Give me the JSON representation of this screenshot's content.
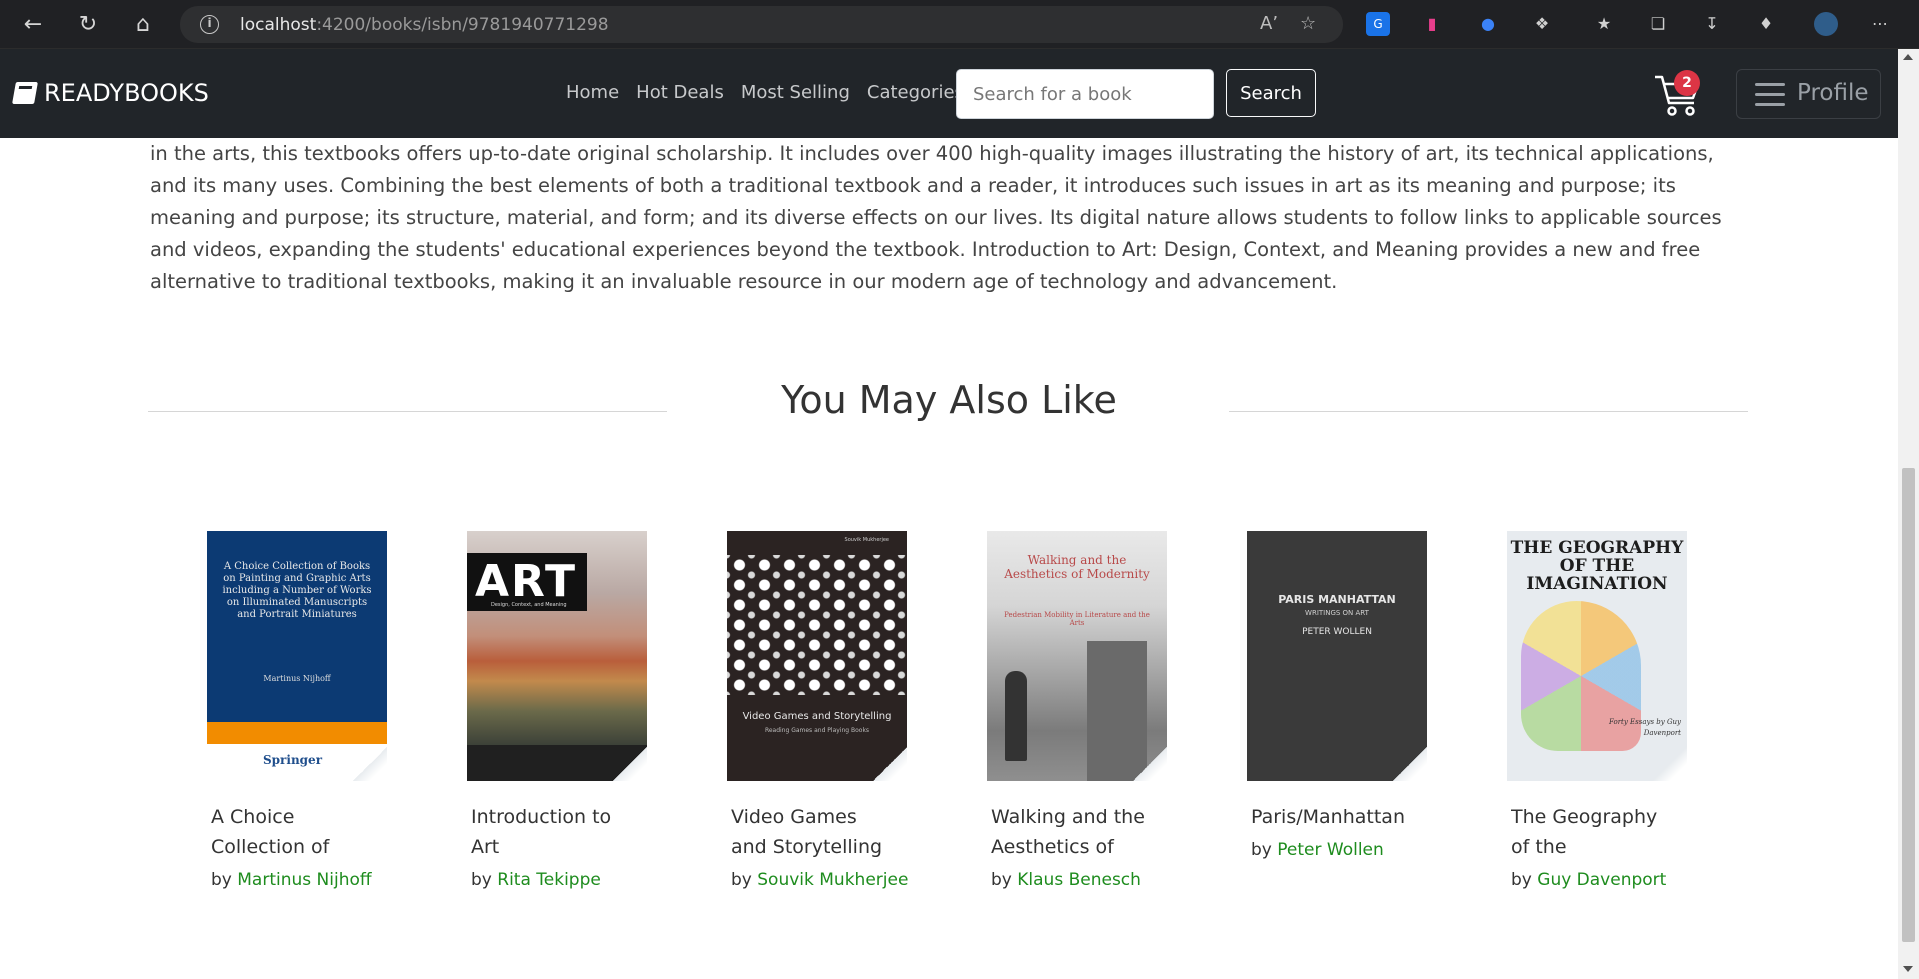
{
  "browser": {
    "url_host": "localhost",
    "url_path": ":4200/books/isbn/9781940771298"
  },
  "navbar": {
    "brand": "READYBOOKS",
    "links": [
      "Home",
      "Hot Deals",
      "Most Selling",
      "Categories"
    ],
    "search_placeholder": "Search for a book",
    "search_button": "Search",
    "cart_count": "2",
    "profile_label": "Profile"
  },
  "description": "in the arts, this textbooks offers up-to-date original scholarship. It includes over 400 high-quality images illustrating the history of art, its technical applications, and its many uses. Combining the best elements of both a traditional textbook and a reader, it introduces such issues in art as its meaning and purpose; its meaning and purpose; its structure, material, and form; and its diverse effects on our lives. Its digital nature allows students to follow links to applicable sources and videos, expanding the students' educational experiences beyond the textbook. Introduction to Art: Design, Context, and Meaning provides a new and free alternative to traditional textbooks, making it an invaluable resource in our modern age of technology and advancement.",
  "recommendations": {
    "title": "You May Also Like",
    "by_label": "by",
    "books": [
      {
        "title": "A Choice Collection of",
        "author": "Martinus Nijhoff",
        "cover_text": "A Choice Collection of Books on Painting and Graphic Arts including a Number of Works on Illuminated Manuscripts and Portrait Miniatures",
        "cover_author": "Martinus Nijhoff",
        "cover_publisher": "Springer"
      },
      {
        "title": "Introduction to Art",
        "author": "Rita Tekippe",
        "cover_text": "ART",
        "cover_sub": "Design, Context, and Meaning"
      },
      {
        "title": "Video Games and Storytelling",
        "author": "Souvik Mukherjee",
        "cover_top": "Souvik Mukherjee",
        "cover_text": "Video Games and Storytelling",
        "cover_sub": "Reading Games and Playing Books"
      },
      {
        "title": "Walking and the Aesthetics of",
        "author": "Klaus Benesch",
        "cover_text": "Walking and the Aesthetics of Modernity",
        "cover_sub": "Pedestrian Mobility in Literature and the Arts"
      },
      {
        "title": "Paris/Manhattan",
        "author": "Peter Wollen",
        "cover_text": "PARIS MANHATTAN",
        "cover_sub": "WRITINGS ON ART",
        "cover_author": "PETER WOLLEN"
      },
      {
        "title": "The Geography of the Imagination",
        "author": "Guy Davenport",
        "cover_text": "THE GEOGRAPHY OF THE IMAGINATION",
        "cover_sub": "Forty Essays by Guy Davenport"
      }
    ]
  }
}
